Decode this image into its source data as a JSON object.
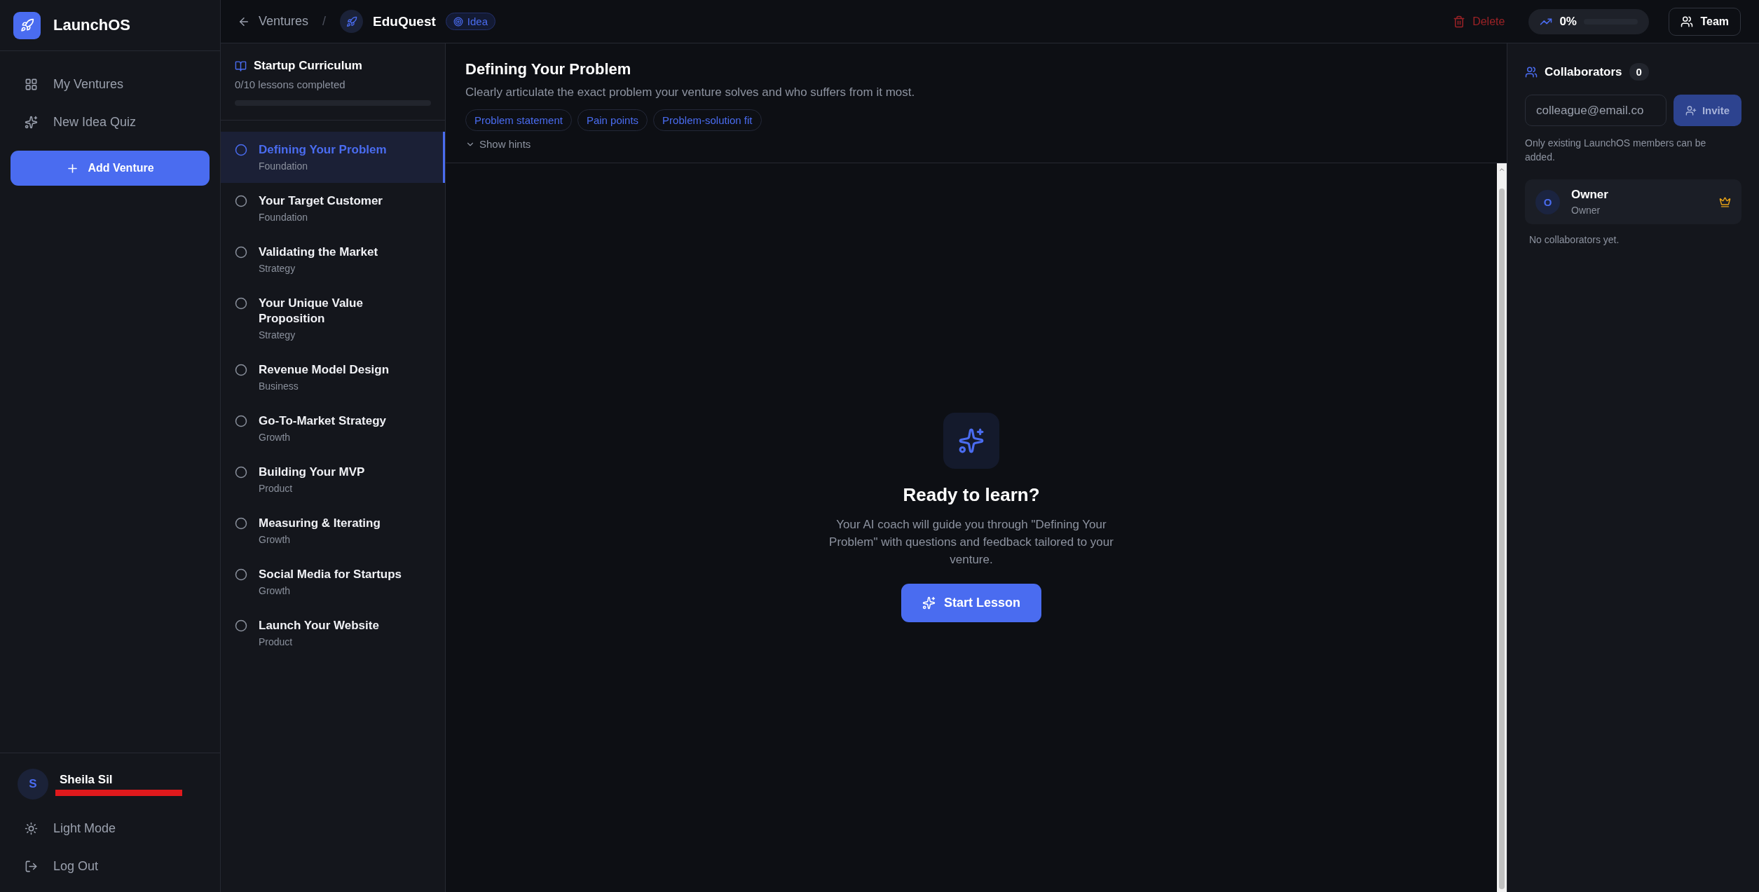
{
  "app": {
    "name": "LaunchOS"
  },
  "nav": [
    {
      "label": "My Ventures",
      "selected": false
    },
    {
      "label": "New Idea Quiz",
      "selected": false
    }
  ],
  "add_button": "Add Venture",
  "user": {
    "initial": "S",
    "name": "Sheila Sil"
  },
  "bottom_actions": [
    {
      "label": "Light Mode"
    },
    {
      "label": "Log Out"
    }
  ],
  "breadcrumb": {
    "back": "Ventures",
    "separator": "/",
    "venture": "EduQuest",
    "stage": "Idea"
  },
  "header_actions": {
    "delete": "Delete",
    "progress": {
      "reading": "0%",
      "level": 0
    },
    "team": "Team"
  },
  "curriculum": {
    "title": "Startup Curriculum",
    "summary": "0/10 lessons completed",
    "level": 0,
    "lessons": [
      {
        "title": "Defining Your Problem",
        "category": "Foundation",
        "selected": true
      },
      {
        "title": "Your Target Customer",
        "category": "Foundation",
        "selected": false
      },
      {
        "title": "Validating the Market",
        "category": "Strategy",
        "selected": false
      },
      {
        "title": "Your Unique Value Proposition",
        "category": "Strategy",
        "selected": false
      },
      {
        "title": "Revenue Model Design",
        "category": "Business",
        "selected": false
      },
      {
        "title": "Go-To-Market Strategy",
        "category": "Growth",
        "selected": false
      },
      {
        "title": "Building Your MVP",
        "category": "Product",
        "selected": false
      },
      {
        "title": "Measuring & Iterating",
        "category": "Growth",
        "selected": false
      },
      {
        "title": "Social Media for Startups",
        "category": "Growth",
        "selected": false
      },
      {
        "title": "Launch Your Website",
        "category": "Product",
        "selected": false
      }
    ]
  },
  "lesson": {
    "title": "Defining Your Problem",
    "description": "Clearly articulate the exact problem your venture solves and who suffers from it most.",
    "tags": [
      "Problem statement",
      "Pain points",
      "Problem-solution fit"
    ],
    "hints": {
      "label": "Show hints",
      "expanded": false
    }
  },
  "empty_state": {
    "title": "Ready to learn?",
    "text": "Your AI coach will guide you through \"Defining Your Problem\" with questions and feedback tailored to your venture.",
    "button": "Start Lesson"
  },
  "collaborators": {
    "title": "Collaborators",
    "count": "0",
    "email_placeholder": "colleague@email.co",
    "invite": {
      "label": "Invite",
      "disabled": true
    },
    "note": "Only existing LaunchOS members can be added.",
    "members": [
      {
        "initial": "O",
        "name": "Owner",
        "role": "Owner"
      }
    ],
    "empty": "No collaborators yet."
  }
}
